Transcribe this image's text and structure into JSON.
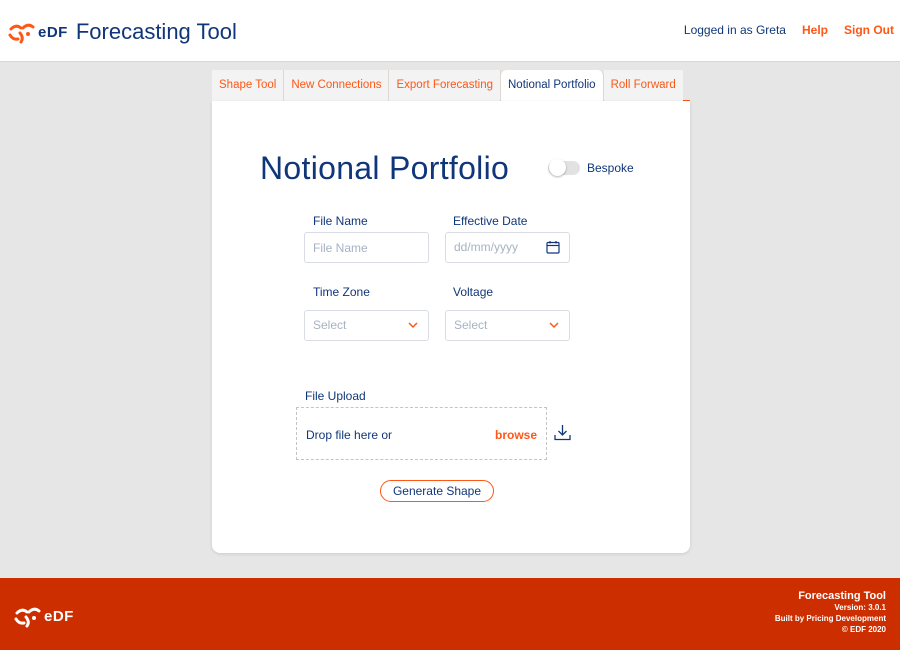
{
  "header": {
    "logo_text": "eDF",
    "app_title": "Forecasting Tool",
    "logged_in": "Logged in as Greta",
    "help": "Help",
    "sign_out": "Sign Out"
  },
  "tabs": [
    {
      "label": "Shape Tool",
      "active": false
    },
    {
      "label": "New Connections",
      "active": false
    },
    {
      "label": "Export Forecasting",
      "active": false
    },
    {
      "label": "Notional Portfolio",
      "active": true
    },
    {
      "label": "Roll Forward",
      "active": false
    }
  ],
  "form": {
    "title": "Notional Portfolio",
    "toggle_label": "Bespoke",
    "toggle_on": false,
    "file_name": {
      "label": "File Name",
      "placeholder": "File Name",
      "value": ""
    },
    "effective_date": {
      "label": "Effective Date",
      "placeholder": "dd/mm/yyyy"
    },
    "time_zone": {
      "label": "Time Zone",
      "value": "Select"
    },
    "voltage": {
      "label": "Voltage",
      "value": "Select"
    },
    "upload": {
      "label": "File Upload",
      "drop_text": "Drop file here or",
      "browse": "browse"
    },
    "generate_button": "Generate Shape"
  },
  "footer": {
    "logo_text": "eDF",
    "title": "Forecasting Tool",
    "version": "Version: 3.0.1",
    "built_by": "Built by Pricing Development",
    "copyright": "© EDF 2020"
  },
  "colors": {
    "brand_navy": "#10367a",
    "accent_orange": "#fe5716",
    "footer_red": "#cc2e00"
  }
}
